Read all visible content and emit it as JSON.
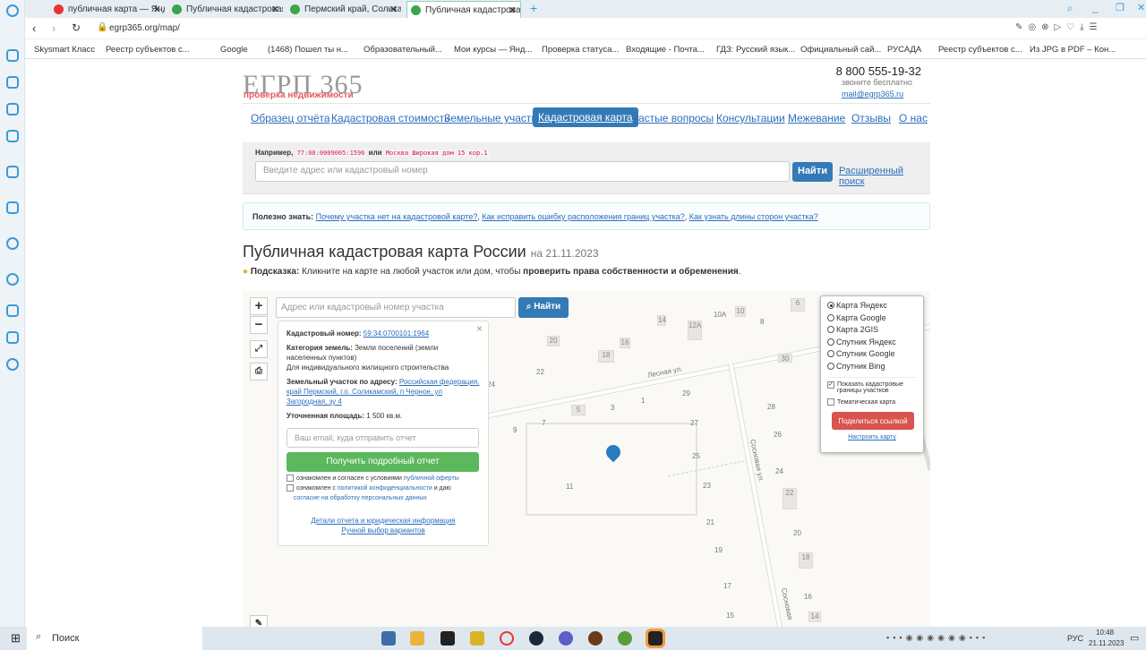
{
  "browser": {
    "tabs": [
      {
        "label": "публичная карта — Яндекс"
      },
      {
        "label": "Публичная кадастровая к"
      },
      {
        "label": "Пермский край, Соликамс"
      },
      {
        "label": "Публичная кадастровая к"
      }
    ],
    "url": "egrp365.org/map/",
    "bookmarks": [
      "Skysmart Класс",
      "Реестр субъектов с...",
      "Google",
      "(1468) Пошел ты н...",
      "Образовательный...",
      "Мои курсы — Янд...",
      "Проверка статуса...",
      "Входящие - Почта...",
      "ГДЗ: Русский язык...",
      "Официальный сай...",
      "РУСАДА",
      "Реестр субъектов с...",
      "Из JPG в PDF – Кон..."
    ]
  },
  "header": {
    "logo": "ЕГРП 365",
    "logo_sub": "проверка недвижимости",
    "phone": "8 800 555-19-32",
    "phone_note": "звоните бесплатно",
    "email": "mail@egrp365.ru"
  },
  "nav": [
    "Образец отчёта",
    "Кадастровая стоимость",
    "Земельные участки",
    "Кадастровая карта",
    "Частые вопросы",
    "Консультации",
    "Межевание",
    "Отзывы",
    "О нас"
  ],
  "search": {
    "example_prefix": "Например,",
    "example_1": "77:08:0009005:1596",
    "example_or": "или",
    "example_2": "Москва Широкая дом 15 кор.1",
    "placeholder": "Введите адрес или кадастровый номер",
    "button": "Найти",
    "advanced": "Расширенный поиск"
  },
  "useful": {
    "label": "Полезно знать:",
    "links": [
      "Почему участка нет на кадастровой карте?",
      "Как исправить ошибку расположения границ участка?",
      "Как узнать длины сторон участка?"
    ]
  },
  "page": {
    "title": "Публичная кадастровая карта России",
    "date": "на 21.11.2023",
    "hint_label": "Подсказка:",
    "hint_text": "Кликните на карте на любой участок или дом, чтобы",
    "hint_bold": "проверить права собственности и обременения"
  },
  "map": {
    "placeholder": "Адрес или кадастровый номер участка",
    "button": "Найти",
    "zoom_in": "+",
    "zoom_out": "−",
    "streets": [
      "Лесная ул.",
      "Сосновая ул.",
      "Сосновая"
    ],
    "labels": [
      "14",
      "10А",
      "10",
      "8",
      "6",
      "20",
      "16",
      "18",
      "12А",
      "22",
      "24",
      "30",
      "29",
      "1",
      "3",
      "5",
      "28",
      "9",
      "7",
      "27",
      "26",
      "25",
      "24",
      "11",
      "23",
      "22",
      "21",
      "20",
      "19",
      "18",
      "17",
      "16",
      "15",
      "14"
    ]
  },
  "popup": {
    "cad_label": "Кадастровый номер:",
    "cad_value": "59:34:0700101:1964",
    "cat_label": "Категория земель:",
    "cat_value": "Земли поселений (земли населенных пунктов)",
    "use": "Для индивидуального жилищного строительства",
    "addr_label": "Земельный участок по адресу:",
    "addr_value": "Российская федерация, край Пермский, г.о. Соликамский, п Черное, ул Загородная, зу 4",
    "area_label": "Уточненная площадь:",
    "area_value": "1 500 кв.м.",
    "email_placeholder": "Ваш email, куда отправить отчет",
    "get_button": "Получить подробный отчет",
    "agree1": "ознакомлен и согласен с условиями",
    "agree1_link": "публичной оферты",
    "agree2": "ознакомлен с",
    "agree2_link": "политикой конфиденциальности",
    "agree2_mid": "и даю",
    "agree2_link2": "согласие на обработку персональных данных",
    "details": "Детали отчета и юридическая информация",
    "manual": "Ручной выбор вариантов"
  },
  "layers": {
    "options": [
      "Карта Яндекс",
      "Карта Google",
      "Карта 2GIS",
      "Спутник Яндекс",
      "Спутник Google",
      "Спутник Bing"
    ],
    "selected": "Карта Яндекс",
    "show_borders": "Показать кадастровые границы участков",
    "show_borders_checked": true,
    "thematic": "Тематическая карта",
    "thematic_checked": false,
    "share": "Поделиться ссылкой",
    "configure": "Настроить карту"
  },
  "taskbar": {
    "search": "Поиск",
    "lang": "РУС",
    "time": "10:48",
    "date": "21.11.2023"
  },
  "colors": {
    "primary": "#337ab7",
    "success": "#5cb85c",
    "danger": "#d9534f",
    "logo_red": "#e25c62"
  }
}
